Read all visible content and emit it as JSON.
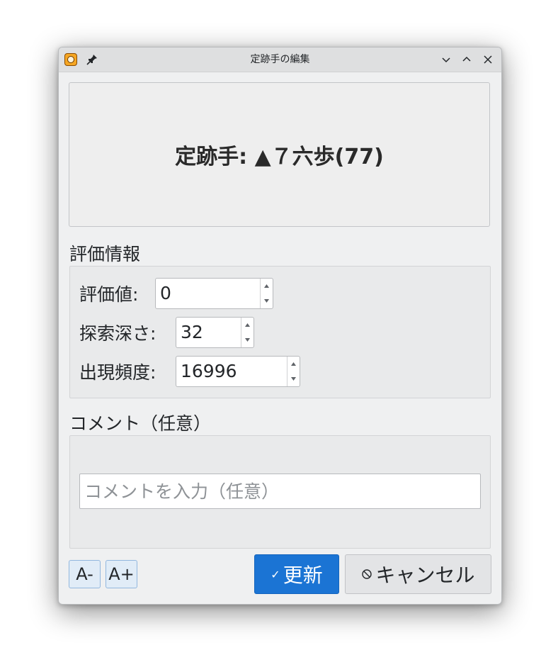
{
  "window": {
    "title": "定跡手の編集",
    "icons": {
      "app": "shogi-app-icon",
      "pin": "pin-icon",
      "minimize": "minimize-icon",
      "maximize": "maximize-icon",
      "close": "close-icon"
    }
  },
  "move": {
    "text": "定跡手: ▲７六歩(77)"
  },
  "evaluation": {
    "group_title": "評価情報",
    "fields": [
      {
        "label": "評価値:",
        "value": "0"
      },
      {
        "label": "探索深さ:",
        "value": "32"
      },
      {
        "label": "出現頻度:",
        "value": "16996"
      }
    ]
  },
  "comment": {
    "group_title": "コメント（任意）",
    "placeholder": "コメントを入力（任意）",
    "value": ""
  },
  "footer": {
    "font_decrease_label": "A-",
    "font_increase_label": "A+",
    "update_label": "更新",
    "update_icon": "check-icon",
    "cancel_label": "キャンセル",
    "cancel_icon": "cancel-icon"
  },
  "colors": {
    "accent": "#1b74d4",
    "window_bg": "#eff0f1",
    "titlebar_bg": "#dedfe0",
    "font_button_bg": "#e1ecf7"
  }
}
